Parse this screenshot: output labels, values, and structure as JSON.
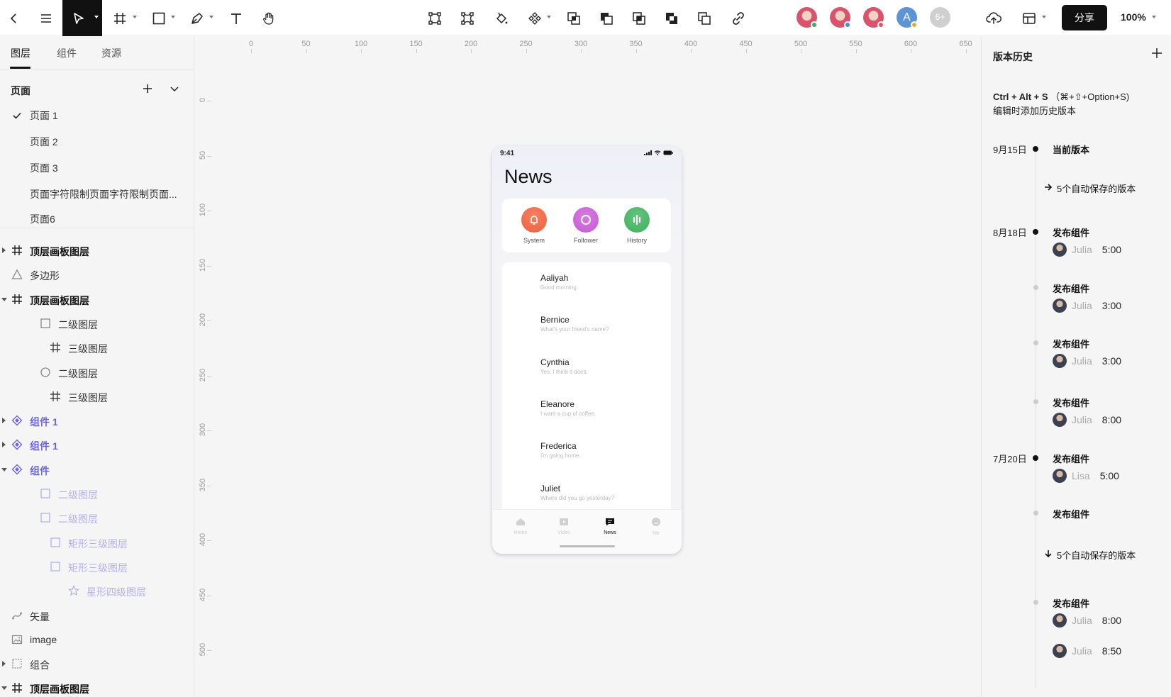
{
  "toolbar": {
    "tools": [
      {
        "name": "back-icon"
      },
      {
        "name": "menu-icon"
      },
      {
        "name": "move-tool-icon"
      },
      {
        "name": "frame-tool-icon"
      },
      {
        "name": "rectangle-tool-icon"
      },
      {
        "name": "pen-tool-icon"
      },
      {
        "name": "text-tool-icon"
      },
      {
        "name": "hand-tool-icon"
      }
    ],
    "avatars": [
      {
        "color": "#d9536b",
        "status": "#2fb55c"
      },
      {
        "color": "#d9536b",
        "status": "#3f8ce6"
      },
      {
        "color": "#d9536b",
        "status": "#e05c5c"
      },
      {
        "letter": "A",
        "color": "#5c94d6",
        "status": "#f0a830"
      },
      {
        "letter": "6+",
        "color": "#cfcfcf"
      }
    ],
    "share_label": "分享",
    "zoom": "100%"
  },
  "left": {
    "tabs": [
      "图层",
      "组件",
      "资源"
    ],
    "pages_title": "页面",
    "pages": [
      "页面 1",
      "页面 2",
      "页面 3",
      "页面字符限制页面字符限制页面...",
      "页面6"
    ],
    "layers": [
      {
        "label": "顶层画板图层",
        "icon": "frame",
        "style": "bold",
        "expand": "r",
        "indent": 0
      },
      {
        "label": "多边形",
        "icon": "triangle",
        "style": "",
        "expand": "",
        "indent": 0
      },
      {
        "label": "顶层画板图层",
        "icon": "frame",
        "style": "bold",
        "expand": "d",
        "indent": 0
      },
      {
        "label": "二级图层",
        "icon": "square",
        "style": "",
        "expand": "",
        "indent": 1
      },
      {
        "label": "三级图层",
        "icon": "frame",
        "style": "",
        "expand": "",
        "indent": 2
      },
      {
        "label": "二级图层",
        "icon": "circle",
        "style": "",
        "expand": "",
        "indent": 1
      },
      {
        "label": "三级图层",
        "icon": "frame",
        "style": "",
        "expand": "",
        "indent": 2
      },
      {
        "label": "组件 1",
        "icon": "component",
        "style": "comp",
        "expand": "r",
        "indent": 0
      },
      {
        "label": "组件 1",
        "icon": "component",
        "style": "comp",
        "expand": "r",
        "indent": 0
      },
      {
        "label": "组件",
        "icon": "component",
        "style": "comp",
        "expand": "d",
        "indent": 0
      },
      {
        "label": "二级图层",
        "icon": "square-p",
        "style": "faded",
        "expand": "",
        "indent": 1
      },
      {
        "label": "二级图层",
        "icon": "square-p",
        "style": "faded",
        "expand": "",
        "indent": 1
      },
      {
        "label": "矩形三级图层",
        "icon": "square-p",
        "style": "faded",
        "expand": "",
        "indent": 2
      },
      {
        "label": "矩形三级图层",
        "icon": "square-p",
        "style": "faded",
        "expand": "",
        "indent": 2
      },
      {
        "label": "星形四级图层",
        "icon": "star",
        "style": "faded",
        "expand": "",
        "indent": 3
      },
      {
        "label": "矢量",
        "icon": "vector",
        "style": "",
        "expand": "",
        "indent": 0
      },
      {
        "label": "image",
        "icon": "image",
        "style": "",
        "expand": "",
        "indent": 0
      },
      {
        "label": "组合",
        "icon": "group",
        "style": "",
        "expand": "r",
        "indent": 0
      },
      {
        "label": "顶层画板图层",
        "icon": "frame",
        "style": "bold",
        "expand": "d",
        "indent": 0
      }
    ]
  },
  "ruler": {
    "x_ticks": [
      "0",
      "50",
      "100",
      "150",
      "200",
      "250",
      "300",
      "350",
      "400",
      "450",
      "500",
      "550",
      "600",
      "650"
    ],
    "y_ticks": [
      "0",
      "50",
      "100",
      "150",
      "200",
      "250",
      "300",
      "350",
      "400",
      "450",
      "500"
    ]
  },
  "phone": {
    "time": "9:41",
    "title": "News",
    "categories": [
      {
        "label": "System",
        "color": "#f0603c"
      },
      {
        "label": "Follower",
        "color": "#c95ad6"
      },
      {
        "label": "History",
        "color": "#3fb25d"
      }
    ],
    "messages": [
      {
        "name": "Aaliyah",
        "text": "Good morning."
      },
      {
        "name": "Bernice",
        "text": "What's your friend's name?"
      },
      {
        "name": "Cynthia",
        "text": "Yes, I think it does."
      },
      {
        "name": "Eleanore",
        "text": "I want a cup of coffee."
      },
      {
        "name": "Frederica",
        "text": "I'm going home."
      },
      {
        "name": "Juliet",
        "text": "Where did you go yesterday?"
      }
    ],
    "tabs": [
      {
        "label": "Home",
        "icon": "home-icon",
        "active": false
      },
      {
        "label": "Video",
        "icon": "video-icon",
        "active": false
      },
      {
        "label": "News",
        "icon": "news-icon",
        "active": true
      },
      {
        "label": "Me",
        "icon": "me-icon",
        "active": false
      }
    ]
  },
  "history": {
    "title": "版本历史",
    "tip_shortcut": "Ctrl + Alt + S",
    "tip_mac": "（⌘+⇧+Option+S)",
    "tip_line2": "编辑时添加历史版本",
    "entries": [
      {
        "date": "9月15日",
        "title": "当前版本",
        "dot": "black"
      },
      {
        "auto": "5个自动保存的版本",
        "arrow": "right"
      },
      {
        "date": "8月18日",
        "title": "发布组件",
        "user": "Julia",
        "time": "5:00",
        "dot": "black"
      },
      {
        "title": "发布组件",
        "user": "Julia",
        "time": "3:00",
        "dot": "grey"
      },
      {
        "title": "发布组件",
        "user": "Julia",
        "time": "3:00",
        "dot": "grey"
      },
      {
        "title": "发布组件",
        "user": "Julia",
        "time": "8:00",
        "dot": "grey"
      },
      {
        "date": "7月20日",
        "title": "发布组件",
        "user": "Lisa",
        "time": "5:00",
        "dot": "black"
      },
      {
        "title": "发布组件",
        "dot": "grey"
      },
      {
        "auto": "5个自动保存的版本",
        "arrow": "down"
      },
      {
        "title": "发布组件",
        "user": "Julia",
        "time": "8:00",
        "dot": "grey"
      },
      {
        "user": "Julia",
        "time": "8:50"
      }
    ]
  }
}
